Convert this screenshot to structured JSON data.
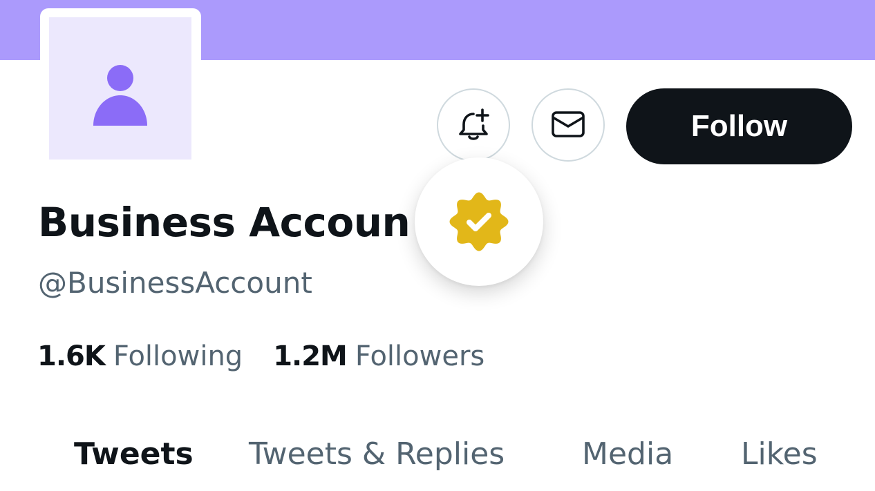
{
  "colors": {
    "banner": "#ab9afc",
    "avatar_bg": "#ece8fd",
    "avatar_figure": "#8b6cf7",
    "verified_badge": "#e2b719",
    "primary_text": "#0f1419",
    "secondary_text": "#536471",
    "follow_button_bg": "#0f1419",
    "icon_button_border": "#cfd9de"
  },
  "icons": {
    "avatar": "person-icon",
    "notifications": "bell-plus-icon",
    "message": "envelope-icon",
    "verified": "verified-badge-icon"
  },
  "profile": {
    "display_name": "Business Accoun",
    "handle": "@BusinessAccount",
    "follow_label": "Follow"
  },
  "stats": [
    {
      "value": "1.6K",
      "label": "Following"
    },
    {
      "value": "1.2M",
      "label": "Followers"
    }
  ],
  "tabs": [
    {
      "label": "Tweets",
      "active": true
    },
    {
      "label": "Tweets & Replies",
      "active": false
    },
    {
      "label": "Media",
      "active": false
    },
    {
      "label": "Likes",
      "active": false
    }
  ]
}
